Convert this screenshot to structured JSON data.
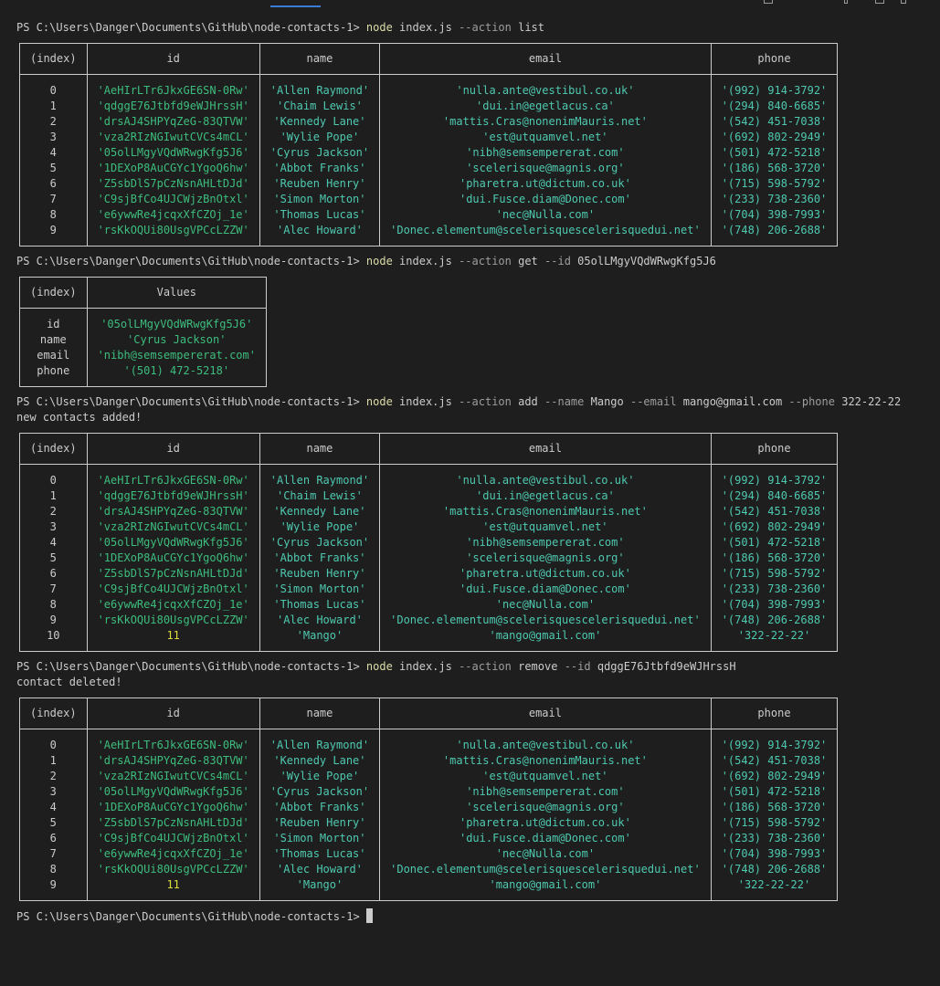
{
  "prompt": "PS C:\\Users\\Danger\\Documents\\GitHub\\node-contacts-1> ",
  "commands": [
    {
      "exe": "node",
      "file": "index.js",
      "args": [
        [
          "flag",
          "--action"
        ],
        [
          "arg",
          "list"
        ]
      ]
    },
    {
      "exe": "node",
      "file": "index.js",
      "args": [
        [
          "flag",
          "--action"
        ],
        [
          "arg",
          "get"
        ],
        [
          "flag",
          "--id"
        ],
        [
          "arg",
          "05olLMgyVQdWRwgKfg5J6"
        ]
      ]
    },
    {
      "exe": "node",
      "file": "index.js",
      "args": [
        [
          "flag",
          "--action"
        ],
        [
          "arg",
          "add"
        ],
        [
          "flag",
          "--name"
        ],
        [
          "arg",
          "Mango"
        ],
        [
          "flag",
          "--email"
        ],
        [
          "arg",
          "mango@gmail.com"
        ],
        [
          "flag",
          "--phone"
        ],
        [
          "arg",
          "322-22-22"
        ]
      ],
      "output": "new contacts added!"
    },
    {
      "exe": "node",
      "file": "index.js",
      "args": [
        [
          "flag",
          "--action"
        ],
        [
          "arg",
          "remove"
        ],
        [
          "flag",
          "--id"
        ],
        [
          "arg",
          "qdggE76Jtbfd9eWJHrssH"
        ]
      ],
      "output": "contact deleted!"
    }
  ],
  "table_headers": [
    "(index)",
    "id",
    "name",
    "email",
    "phone"
  ],
  "get_headers": [
    "(index)",
    "Values"
  ],
  "list1": [
    [
      "0",
      "'AeHIrLTr6JkxGE6SN-0Rw'",
      "'Allen Raymond'",
      "'nulla.ante@vestibul.co.uk'",
      "'(992) 914-3792'"
    ],
    [
      "1",
      "'qdggE76Jtbfd9eWJHrssH'",
      "'Chaim Lewis'",
      "'dui.in@egetlacus.ca'",
      "'(294) 840-6685'"
    ],
    [
      "2",
      "'drsAJ4SHPYqZeG-83QTVW'",
      "'Kennedy Lane'",
      "'mattis.Cras@nonenimMauris.net'",
      "'(542) 451-7038'"
    ],
    [
      "3",
      "'vza2RIzNGIwutCVCs4mCL'",
      "'Wylie Pope'",
      "'est@utquamvel.net'",
      "'(692) 802-2949'"
    ],
    [
      "4",
      "'05olLMgyVQdWRwgKfg5J6'",
      "'Cyrus Jackson'",
      "'nibh@semsempererat.com'",
      "'(501) 472-5218'"
    ],
    [
      "5",
      "'1DEXoP8AuCGYc1YgoQ6hw'",
      "'Abbot Franks'",
      "'scelerisque@magnis.org'",
      "'(186) 568-3720'"
    ],
    [
      "6",
      "'Z5sbDlS7pCzNsnAHLtDJd'",
      "'Reuben Henry'",
      "'pharetra.ut@dictum.co.uk'",
      "'(715) 598-5792'"
    ],
    [
      "7",
      "'C9sjBfCo4UJCWjzBnOtxl'",
      "'Simon Morton'",
      "'dui.Fusce.diam@Donec.com'",
      "'(233) 738-2360'"
    ],
    [
      "8",
      "'e6ywwRe4jcqxXfCZOj_1e'",
      "'Thomas Lucas'",
      "'nec@Nulla.com'",
      "'(704) 398-7993'"
    ],
    [
      "9",
      "'rsKkOQUi80UsgVPCcLZZW'",
      "'Alec Howard'",
      "'Donec.elementum@scelerisquescelerisquedui.net'",
      "'(748) 206-2688'"
    ]
  ],
  "get_result": [
    [
      "id",
      "'05olLMgyVQdWRwgKfg5J6'"
    ],
    [
      "name",
      "'Cyrus Jackson'"
    ],
    [
      "email",
      "'nibh@semsempererat.com'"
    ],
    [
      "phone",
      "'(501) 472-5218'"
    ]
  ],
  "list2": [
    [
      "0",
      "'AeHIrLTr6JkxGE6SN-0Rw'",
      "'Allen Raymond'",
      "'nulla.ante@vestibul.co.uk'",
      "'(992) 914-3792'"
    ],
    [
      "1",
      "'qdggE76Jtbfd9eWJHrssH'",
      "'Chaim Lewis'",
      "'dui.in@egetlacus.ca'",
      "'(294) 840-6685'"
    ],
    [
      "2",
      "'drsAJ4SHPYqZeG-83QTVW'",
      "'Kennedy Lane'",
      "'mattis.Cras@nonenimMauris.net'",
      "'(542) 451-7038'"
    ],
    [
      "3",
      "'vza2RIzNGIwutCVCs4mCL'",
      "'Wylie Pope'",
      "'est@utquamvel.net'",
      "'(692) 802-2949'"
    ],
    [
      "4",
      "'05olLMgyVQdWRwgKfg5J6'",
      "'Cyrus Jackson'",
      "'nibh@semsempererat.com'",
      "'(501) 472-5218'"
    ],
    [
      "5",
      "'1DEXoP8AuCGYc1YgoQ6hw'",
      "'Abbot Franks'",
      "'scelerisque@magnis.org'",
      "'(186) 568-3720'"
    ],
    [
      "6",
      "'Z5sbDlS7pCzNsnAHLtDJd'",
      "'Reuben Henry'",
      "'pharetra.ut@dictum.co.uk'",
      "'(715) 598-5792'"
    ],
    [
      "7",
      "'C9sjBfCo4UJCWjzBnOtxl'",
      "'Simon Morton'",
      "'dui.Fusce.diam@Donec.com'",
      "'(233) 738-2360'"
    ],
    [
      "8",
      "'e6ywwRe4jcqxXfCZOj_1e'",
      "'Thomas Lucas'",
      "'nec@Nulla.com'",
      "'(704) 398-7993'"
    ],
    [
      "9",
      "'rsKkOQUi80UsgVPCcLZZW'",
      "'Alec Howard'",
      "'Donec.elementum@scelerisquescelerisquedui.net'",
      "'(748) 206-2688'"
    ],
    [
      "10",
      "11",
      "'Mango'",
      "'mango@gmail.com'",
      "'322-22-22'"
    ]
  ],
  "list3": [
    [
      "0",
      "'AeHIrLTr6JkxGE6SN-0Rw'",
      "'Allen Raymond'",
      "'nulla.ante@vestibul.co.uk'",
      "'(992) 914-3792'"
    ],
    [
      "1",
      "'drsAJ4SHPYqZeG-83QTVW'",
      "'Kennedy Lane'",
      "'mattis.Cras@nonenimMauris.net'",
      "'(542) 451-7038'"
    ],
    [
      "2",
      "'vza2RIzNGIwutCVCs4mCL'",
      "'Wylie Pope'",
      "'est@utquamvel.net'",
      "'(692) 802-2949'"
    ],
    [
      "3",
      "'05olLMgyVQdWRwgKfg5J6'",
      "'Cyrus Jackson'",
      "'nibh@semsempererat.com'",
      "'(501) 472-5218'"
    ],
    [
      "4",
      "'1DEXoP8AuCGYc1YgoQ6hw'",
      "'Abbot Franks'",
      "'scelerisque@magnis.org'",
      "'(186) 568-3720'"
    ],
    [
      "5",
      "'Z5sbDlS7pCzNsnAHLtDJd'",
      "'Reuben Henry'",
      "'pharetra.ut@dictum.co.uk'",
      "'(715) 598-5792'"
    ],
    [
      "6",
      "'C9sjBfCo4UJCWjzBnOtxl'",
      "'Simon Morton'",
      "'dui.Fusce.diam@Donec.com'",
      "'(233) 738-2360'"
    ],
    [
      "7",
      "'e6ywwRe4jcqxXfCZOj_1e'",
      "'Thomas Lucas'",
      "'nec@Nulla.com'",
      "'(704) 398-7993'"
    ],
    [
      "8",
      "'rsKkOQUi80UsgVPCcLZZW'",
      "'Alec Howard'",
      "'Donec.elementum@scelerisquescelerisquedui.net'",
      "'(748) 206-2688'"
    ],
    [
      "9",
      "11",
      "'Mango'",
      "'mango@gmail.com'",
      "'322-22-22'"
    ]
  ],
  "colors": {
    "background": "#1e1e1e",
    "command": "#dcdcaa",
    "string": "#4ec9b0",
    "number": "#dcdc3c",
    "text": "#cccccc"
  },
  "icons": [
    "tab-underline",
    "window-icons"
  ]
}
